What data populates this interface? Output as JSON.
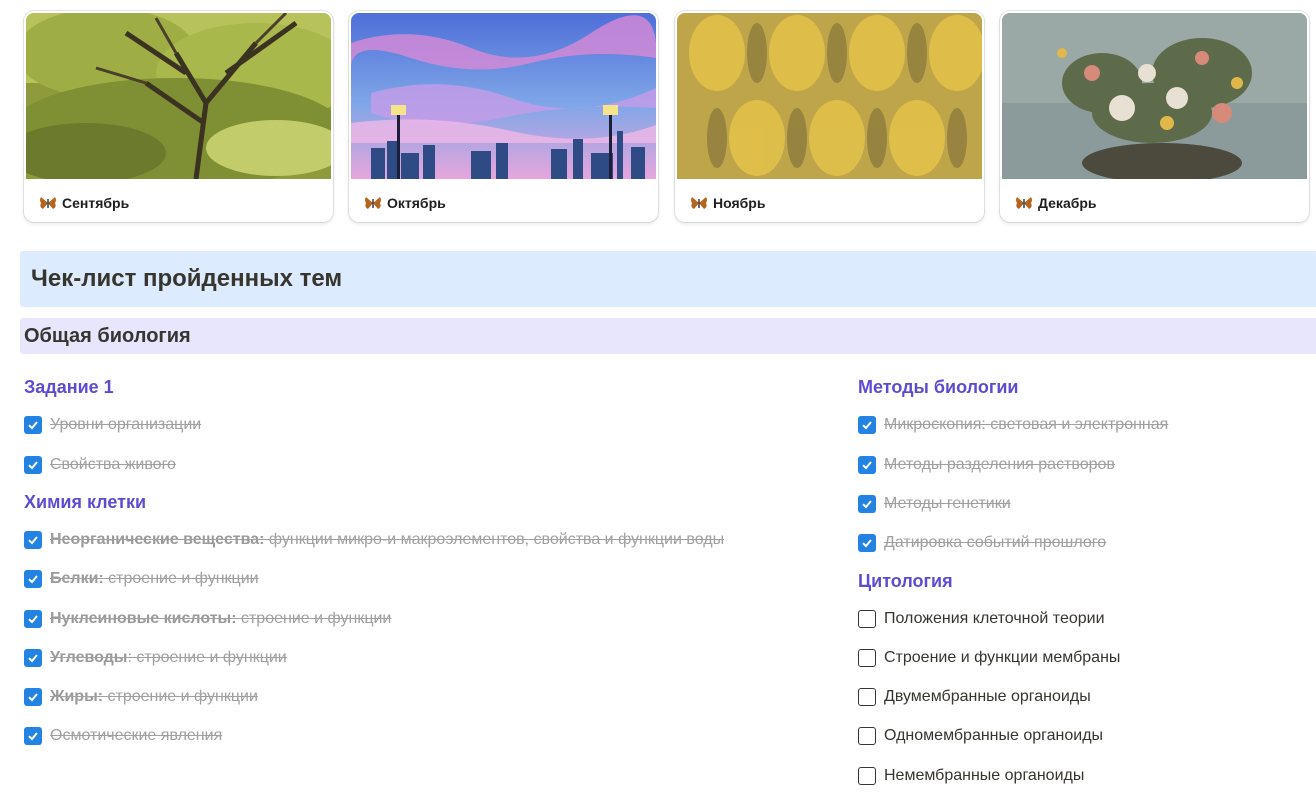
{
  "gallery": {
    "cards": [
      {
        "title": "Сентябрь",
        "icon": "butterfly-icon",
        "cover": "painting-green-tree-landscape"
      },
      {
        "title": "Октябрь",
        "icon": "butterfly-icon",
        "cover": "pixel-art-pink-sky-city-lamps"
      },
      {
        "title": "Ноябрь",
        "icon": "butterfly-icon",
        "cover": "gold-damask-pattern"
      },
      {
        "title": "Декабрь",
        "icon": "butterfly-icon",
        "cover": "flower-still-life-painting"
      }
    ]
  },
  "page": {
    "heading": "Чек-лист пройденных тем",
    "section": "Общая биология"
  },
  "left": {
    "groups": [
      {
        "title": "Задание 1",
        "items": [
          {
            "bold": "",
            "text": "Уровни организации",
            "checked": true
          },
          {
            "bold": "",
            "text": "Свойства живого",
            "checked": true
          }
        ]
      },
      {
        "title": "Химия клетки",
        "items": [
          {
            "bold": "Неорганические вещества:",
            "text": " функции микро-и макроэлементов, свойства и функции воды",
            "checked": true
          },
          {
            "bold": "Белки:",
            "text": " строение и функции",
            "checked": true
          },
          {
            "bold": "Нуклеиновые кислоты:",
            "text": " строение и функции",
            "checked": true
          },
          {
            "bold": "Углеводы",
            "text": ": строение и функции",
            "checked": true
          },
          {
            "bold": "Жиры:",
            "text": " строение и функции",
            "checked": true
          },
          {
            "bold": "",
            "text": "Осмотические явления",
            "checked": true
          }
        ]
      }
    ]
  },
  "right": {
    "groups": [
      {
        "title": "Методы биологии",
        "items": [
          {
            "bold": "",
            "text": "Микроскопия: световая и электронная",
            "checked": true
          },
          {
            "bold": "",
            "text": "Методы разделения растворов",
            "checked": true
          },
          {
            "bold": "",
            "text": "Методы генетики",
            "checked": true
          },
          {
            "bold": "",
            "text": "Датировка событий прошлого",
            "checked": true
          }
        ]
      },
      {
        "title": "Цитология",
        "items": [
          {
            "bold": "",
            "text": "Положения клеточной теории",
            "checked": false
          },
          {
            "bold": "",
            "text": "Строение и функции мембраны",
            "checked": false
          },
          {
            "bold": "",
            "text": "Двумембранные органоиды",
            "checked": false
          },
          {
            "bold": "",
            "text": "Одномембранные органоиды",
            "checked": false
          },
          {
            "bold": "",
            "text": "Немембранные органоиды",
            "checked": false
          }
        ]
      }
    ]
  },
  "colors": {
    "accent_checkbox": "#2383e2",
    "heading_bg": "#ddebfe",
    "section_bg": "#e7e6fd",
    "group_title": "#5e4cd0"
  }
}
